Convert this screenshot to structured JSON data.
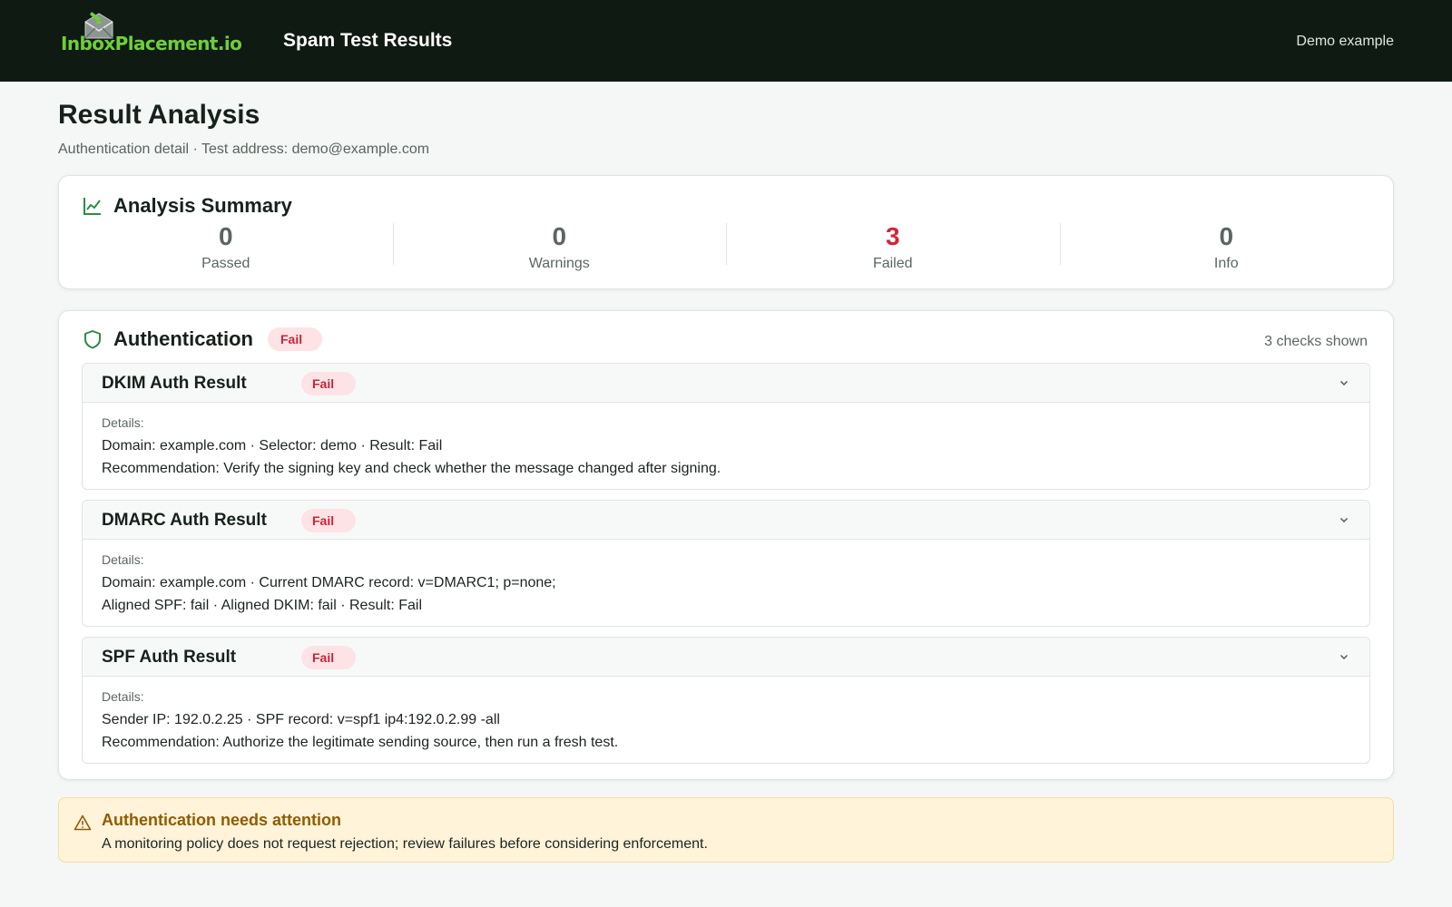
{
  "topbar": {
    "logo_text": "InboxPlacement.io",
    "title": "Spam Test Results",
    "right_label": "Demo example"
  },
  "page": {
    "title": "Result Analysis",
    "subtitle": "Authentication detail · Test address: demo@example.com"
  },
  "summary": {
    "title": "Analysis Summary",
    "icon": "chart-line-icon",
    "stats": [
      {
        "value": "0",
        "label": "Passed"
      },
      {
        "value": "0",
        "label": "Warnings"
      },
      {
        "value": "3",
        "label": "Failed"
      },
      {
        "value": "0",
        "label": "Info"
      }
    ]
  },
  "authentication": {
    "title": "Authentication",
    "icon": "shield-icon",
    "status": "Fail",
    "checks_shown": "3 checks shown",
    "checks": [
      {
        "name": "DKIM Auth Result",
        "status": "Fail",
        "details_label": "Details:",
        "lines": [
          "Domain: example.com · Selector: demo · Result: Fail",
          "Recommendation: Verify the signing key and check whether the message changed after signing."
        ]
      },
      {
        "name": "DMARC Auth Result",
        "status": "Fail",
        "details_label": "Details:",
        "lines": [
          "Domain: example.com · Current DMARC record: v=DMARC1; p=none;",
          "Aligned SPF: fail · Aligned DKIM: fail · Result: Fail"
        ]
      },
      {
        "name": "SPF Auth Result",
        "status": "Fail",
        "details_label": "Details:",
        "lines": [
          "Sender IP: 192.0.2.25 · SPF record: v=spf1 ip4:192.0.2.99 -all",
          "Recommendation: Authorize the legitimate sending source, then run a fresh test."
        ]
      }
    ]
  },
  "alert": {
    "icon": "warning-triangle-icon",
    "title": "Authentication needs attention",
    "text": "A monitoring policy does not request rejection; review failures before considering enforcement."
  },
  "colors": {
    "topbar_bg": "#0e1a12",
    "logo_green": "#6fcf3a",
    "fail_red": "#d0263a",
    "fail_badge_bg": "#fde3e6",
    "alert_bg": "#fff3d9",
    "alert_title": "#915b00",
    "icon_green": "#2f8a4a"
  }
}
